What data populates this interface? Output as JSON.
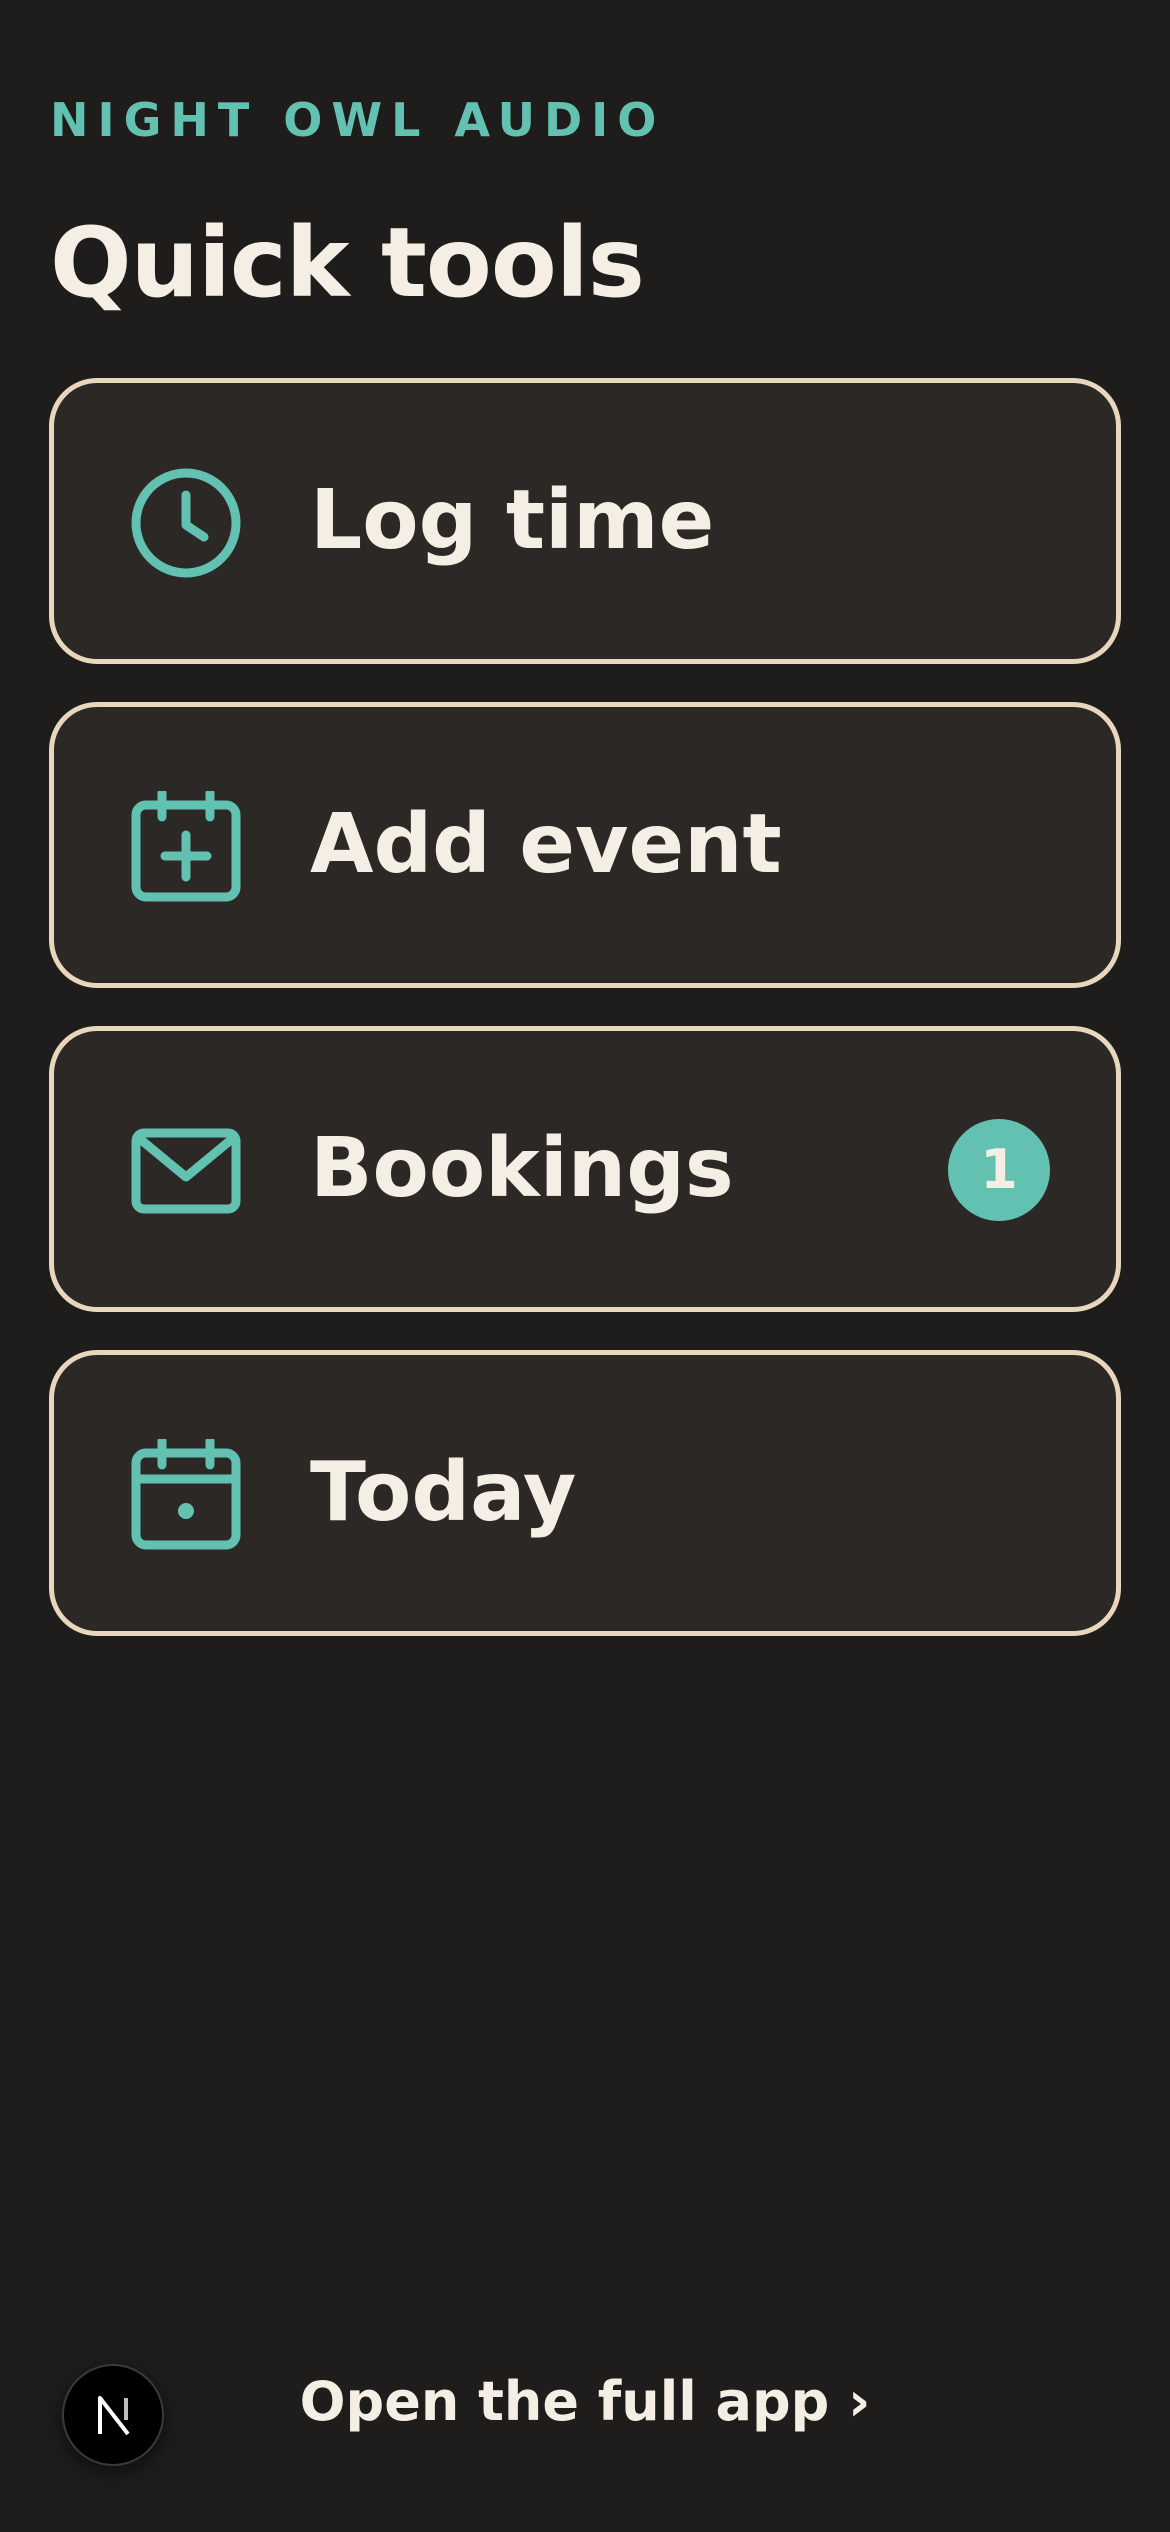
{
  "brand": "NIGHT OWL AUDIO",
  "page_title": "Quick tools",
  "accent_color": "#63c1b1",
  "card_border_color": "#e9d7bd",
  "tools": [
    {
      "label": "Log time",
      "icon": "clock-icon"
    },
    {
      "label": "Add event",
      "icon": "calendar-plus-icon"
    },
    {
      "label": "Bookings",
      "icon": "mail-icon",
      "badge": "1"
    },
    {
      "label": "Today",
      "icon": "calendar-today-icon"
    }
  ],
  "footer": {
    "open_app_label": "Open the full app ›",
    "dev_badge_letter": "N"
  }
}
